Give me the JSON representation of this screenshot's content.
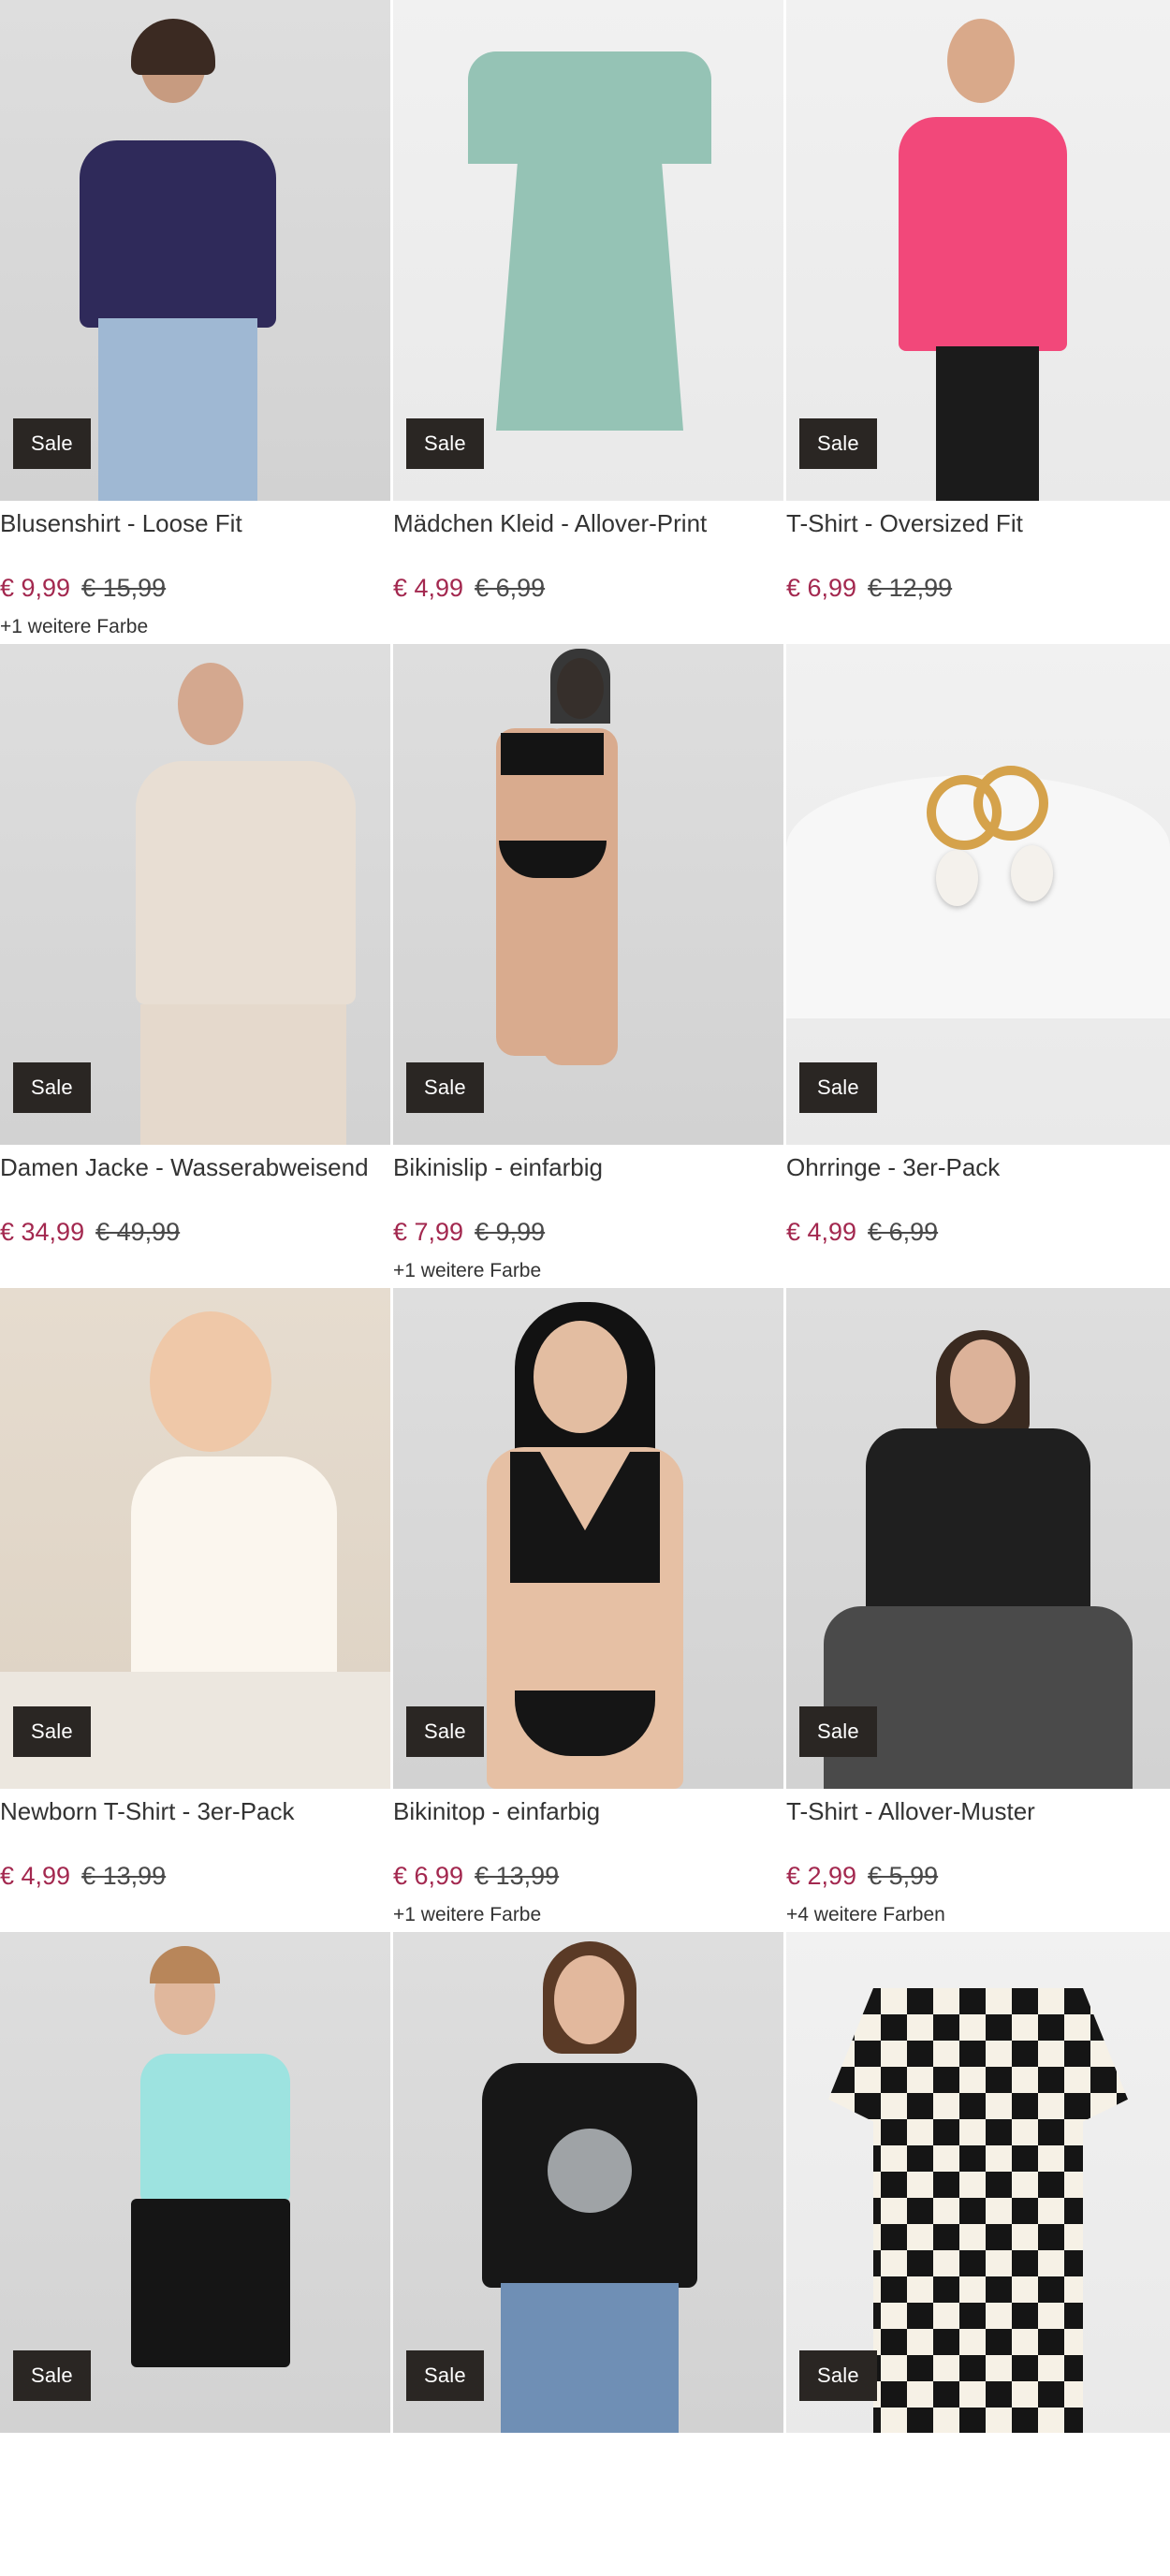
{
  "badge_label": "Sale",
  "products": [
    {
      "title": "Blusenshirt - Loose Fit",
      "price": "€ 9,99",
      "old_price": "€ 15,99",
      "colors": "+1 weitere Farbe"
    },
    {
      "title": "Mädchen Kleid - Allover-Print",
      "price": "€ 4,99",
      "old_price": "€ 6,99",
      "colors": ""
    },
    {
      "title": "T-Shirt - Oversized Fit",
      "price": "€ 6,99",
      "old_price": "€ 12,99",
      "colors": ""
    },
    {
      "title": "Damen Jacke - Wasserabweisend",
      "price": "€ 34,99",
      "old_price": "€ 49,99",
      "colors": ""
    },
    {
      "title": "Bikinislip - einfarbig",
      "price": "€ 7,99",
      "old_price": "€ 9,99",
      "colors": "+1 weitere Farbe"
    },
    {
      "title": "Ohrringe - 3er-Pack",
      "price": "€ 4,99",
      "old_price": "€ 6,99",
      "colors": ""
    },
    {
      "title": "Newborn T-Shirt - 3er-Pack",
      "price": "€ 4,99",
      "old_price": "€ 13,99",
      "colors": ""
    },
    {
      "title": "Bikinitop - einfarbig",
      "price": "€ 6,99",
      "old_price": "€ 13,99",
      "colors": "+1 weitere Farbe"
    },
    {
      "title": "T-Shirt - Allover-Muster",
      "price": "€ 2,99",
      "old_price": "€ 5,99",
      "colors": "+4 weitere Farben"
    },
    {
      "title": "",
      "price": "",
      "old_price": "",
      "colors": ""
    },
    {
      "title": "",
      "price": "",
      "old_price": "",
      "colors": ""
    },
    {
      "title": "",
      "price": "",
      "old_price": "",
      "colors": ""
    }
  ],
  "colors": {
    "price": "#a3284f",
    "badge_bg": "#2a2623"
  }
}
